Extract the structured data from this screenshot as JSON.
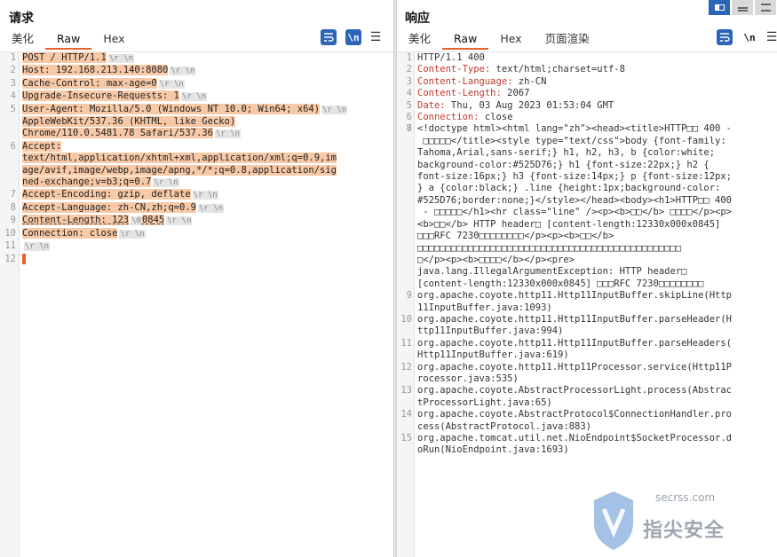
{
  "request": {
    "title": "请求",
    "tabs": [
      "美化",
      "Raw",
      "Hex"
    ],
    "active_tab": "Raw",
    "icons": {
      "wrap": "≡",
      "newline": "\\n",
      "menu": "☰"
    },
    "lines": [
      {
        "num": "1",
        "parts": [
          {
            "t": "POST / HTTP/1.1",
            "c": "v"
          }
        ]
      },
      {
        "num": "2",
        "parts": [
          {
            "t": "Host: 192.168.213.140:8080",
            "c": "v"
          }
        ]
      },
      {
        "num": "3",
        "parts": [
          {
            "t": "Cache-Control: max-age=0",
            "c": "v"
          }
        ]
      },
      {
        "num": "4",
        "parts": [
          {
            "t": "Upgrade-Insecure-Requests: 1",
            "c": "v"
          }
        ]
      },
      {
        "num": "5",
        "parts": [
          {
            "t": "User-Agent: Mozilla/5.0 (Windows NT 10.0; Win64; x64)",
            "c": "v"
          }
        ]
      },
      {
        "num": "",
        "parts": [
          {
            "t": "AppleWebKit/537.36 (KHTML, like Gecko)",
            "c": "v"
          }
        ]
      },
      {
        "num": "",
        "parts": [
          {
            "t": "Chrome/110.0.5481.78 Safari/537.36",
            "c": "v"
          }
        ]
      },
      {
        "num": "6",
        "parts": [
          {
            "t": "Accept:",
            "c": "v"
          }
        ]
      },
      {
        "num": "",
        "parts": [
          {
            "t": "text/html,application/xhtml+xml,application/xml;q=0.9,im",
            "c": "v"
          }
        ]
      },
      {
        "num": "",
        "parts": [
          {
            "t": "age/avif,image/webp,image/apng,*/*;q=0.8,application/sig",
            "c": "v"
          }
        ]
      },
      {
        "num": "",
        "parts": [
          {
            "t": "ned-exchange;v=b3;q=0.7",
            "c": "v"
          }
        ]
      },
      {
        "num": "7",
        "parts": [
          {
            "t": "Accept-Encoding: gzip, deflate",
            "c": "v"
          }
        ]
      },
      {
        "num": "8",
        "parts": [
          {
            "t": "Accept-Language: zh-CN,zh;q=0.9",
            "c": "v"
          }
        ]
      },
      {
        "num": "9",
        "parts": [
          {
            "t": "Content-Length: 123",
            "c": "v"
          },
          {
            "t": "\\0",
            "c": "crlf"
          },
          {
            "t": "08",
            "c": "v"
          },
          {
            "t": "45",
            "c": "v"
          }
        ]
      },
      {
        "num": "10",
        "parts": [
          {
            "t": "Connection: close",
            "c": "v"
          }
        ]
      },
      {
        "num": "11",
        "parts": [
          {
            "t": "",
            "c": "v"
          }
        ]
      },
      {
        "num": "12",
        "parts": [
          {
            "t": "",
            "c": "v"
          }
        ]
      }
    ],
    "crlf": "\\r \\n"
  },
  "response": {
    "title": "响应",
    "tabs": [
      "美化",
      "Raw",
      "Hex",
      "页面渲染"
    ],
    "active_tab": "Raw",
    "icons": {
      "wrap": "≡",
      "newline": "\\n",
      "menu": "☰"
    },
    "lines": [
      {
        "num": "1",
        "text": "HTTP/1.1 400"
      },
      {
        "num": "2",
        "key": "Content-Type:",
        "val": " text/html;charset=utf-8"
      },
      {
        "num": "3",
        "key": "Content-Language:",
        "val": " zh-CN"
      },
      {
        "num": "4",
        "key": "Content-Length:",
        "val": " 2067"
      },
      {
        "num": "5",
        "key": "Date:",
        "val": " Thu, 03 Aug 2023 01:53:04 GMT"
      },
      {
        "num": "6",
        "key": "Connection:",
        "val": " close"
      },
      {
        "num": "7",
        "text": ""
      },
      {
        "num": "8",
        "html": "<!doctype html><html lang=\"zh\"><head><title>HTTP□□ 400 -"
      },
      {
        "num": "",
        "html": " □□□□□</title><style type=\"text/css\">body {font-family:"
      },
      {
        "num": "",
        "html": "Tahoma,Arial,sans-serif;} h1, h2, h3, b {color:white;"
      },
      {
        "num": "",
        "html": "background-color:#525D76;} h1 {font-size:22px;} h2 {"
      },
      {
        "num": "",
        "html": "font-size:16px;} h3 {font-size:14px;} p {font-size:12px;"
      },
      {
        "num": "",
        "html": "} a {color:black;} .line {height:1px;background-color:"
      },
      {
        "num": "",
        "html": "#525D76;border:none;}</style></head><body><h1>HTTP□□ 400"
      },
      {
        "num": "",
        "html": " - □□□□□</h1><hr class=\"line\" /><p><b>□□</b> □□□□</p><p>"
      },
      {
        "num": "",
        "html": "<b>□□</b> HTTP header□ [content-length:12330x000x0845]"
      },
      {
        "num": "",
        "html": "□□□RFC 7230□□□□□□□□</p><p><b>□□</b>"
      },
      {
        "num": "",
        "html": "□□□□□□□□□□□□□□□□□□□□□□□□□□□□□□□□□□□□□□□□□□□□□□□"
      },
      {
        "num": "",
        "html": "□</p><p><b>□□□□</b></p><pre>"
      },
      {
        "num": "",
        "html": "java.lang.IllegalArgumentException: HTTP header□"
      },
      {
        "num": "",
        "html": "[content-length:12330x000x0845] □□□RFC 7230□□□□□□□□"
      },
      {
        "num": "9",
        "text": ""
      },
      {
        "num": "",
        "text": "org.apache.coyote.http11.Http11InputBuffer.skipLine(Http"
      },
      {
        "num": "",
        "text": "11InputBuffer.java:1093)"
      },
      {
        "num": "10",
        "text": ""
      },
      {
        "num": "",
        "text": "org.apache.coyote.http11.Http11InputBuffer.parseHeader(H"
      },
      {
        "num": "",
        "text": "ttp11InputBuffer.java:994)"
      },
      {
        "num": "11",
        "text": ""
      },
      {
        "num": "",
        "text": "org.apache.coyote.http11.Http11InputBuffer.parseHeaders("
      },
      {
        "num": "",
        "text": "Http11InputBuffer.java:619)"
      },
      {
        "num": "12",
        "text": ""
      },
      {
        "num": "",
        "text": "org.apache.coyote.http11.Http11Processor.service(Http11P"
      },
      {
        "num": "",
        "text": "rocessor.java:535)"
      },
      {
        "num": "13",
        "text": ""
      },
      {
        "num": "",
        "text": "org.apache.coyote.AbstractProcessorLight.process(Abstrac"
      },
      {
        "num": "",
        "text": "tProcessorLight.java:65)"
      },
      {
        "num": "14",
        "text": ""
      },
      {
        "num": "",
        "text": "org.apache.coyote.AbstractProtocol$ConnectionHandler.pro"
      },
      {
        "num": "",
        "text": "cess(AbstractProtocol.java:883)"
      },
      {
        "num": "15",
        "text": ""
      },
      {
        "num": "",
        "text": "org.apache.tomcat.util.net.NioEndpoint$SocketProcessor.d"
      },
      {
        "num": "",
        "text": "oRun(NioEndpoint.java:1693)"
      }
    ]
  },
  "watermark": {
    "site": "secrss.com",
    "brand": "指尖安全"
  },
  "colors": {
    "accent": "#e8622c",
    "selection": "#f8c9a6",
    "blue": "#2b65b8"
  }
}
